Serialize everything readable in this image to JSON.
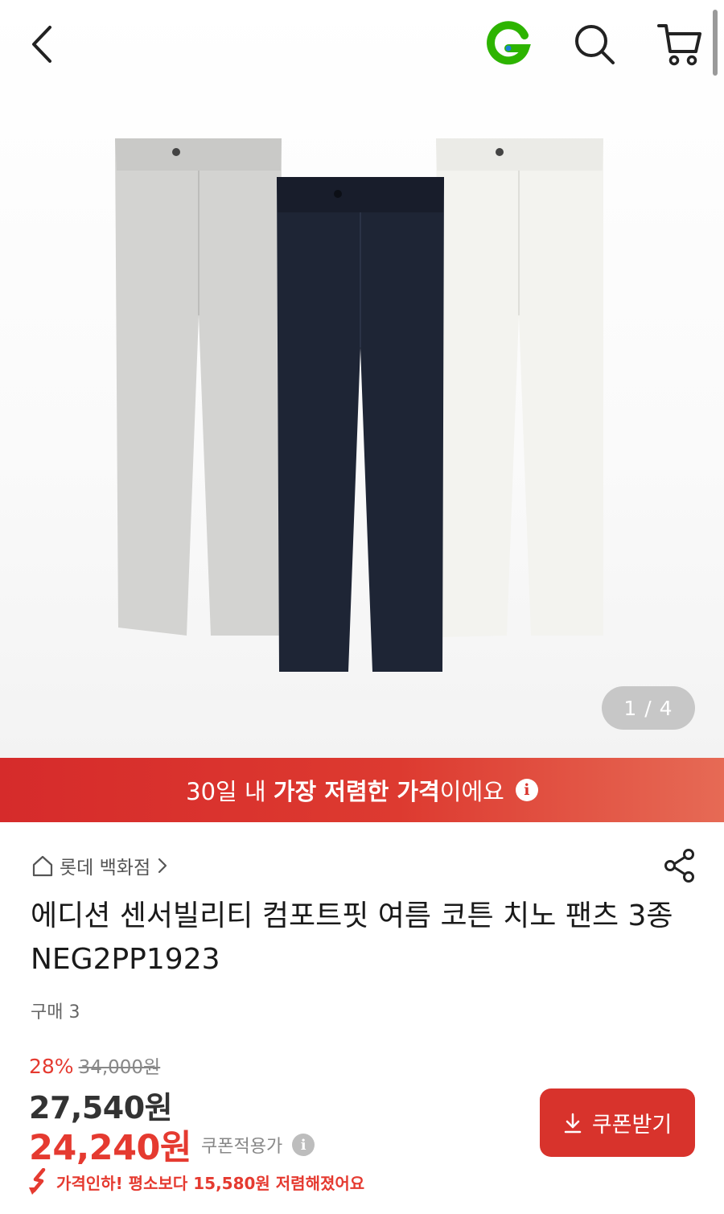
{
  "header": {
    "back_icon": "chevron-left-icon",
    "logo_letter": "G",
    "search_icon": "search-icon",
    "cart_icon": "cart-icon",
    "logo_color": "#2db400"
  },
  "gallery": {
    "page_indicator": "1 / 4",
    "product_colors": [
      "#d2d2d0",
      "#1e2535",
      "#f2f2ee"
    ]
  },
  "banner": {
    "prefix": "30일 내 ",
    "emphasis": "가장 저렴한 가격",
    "suffix": "이에요",
    "info_glyph": "i",
    "color": "#d62b2b"
  },
  "product": {
    "store": "롯데 백화점",
    "title": "에디션 센서빌리티 컴포트핏 여름 코튼 치노 팬츠 3종 NEG2PP1923",
    "purchases": "구매 3"
  },
  "price": {
    "discount_rate": "28%",
    "original": "34,000원",
    "sale": "27,540원",
    "coupon_price": "24,240원",
    "coupon_label": "쿠폰적용가",
    "coupon_info_glyph": "i",
    "drop_notice": "가격인하! 평소보다 15,580원 저렴해졌어요",
    "accent": "#e53a30"
  },
  "coupon_button": {
    "label": "쿠폰받기",
    "icon": "download-icon"
  }
}
